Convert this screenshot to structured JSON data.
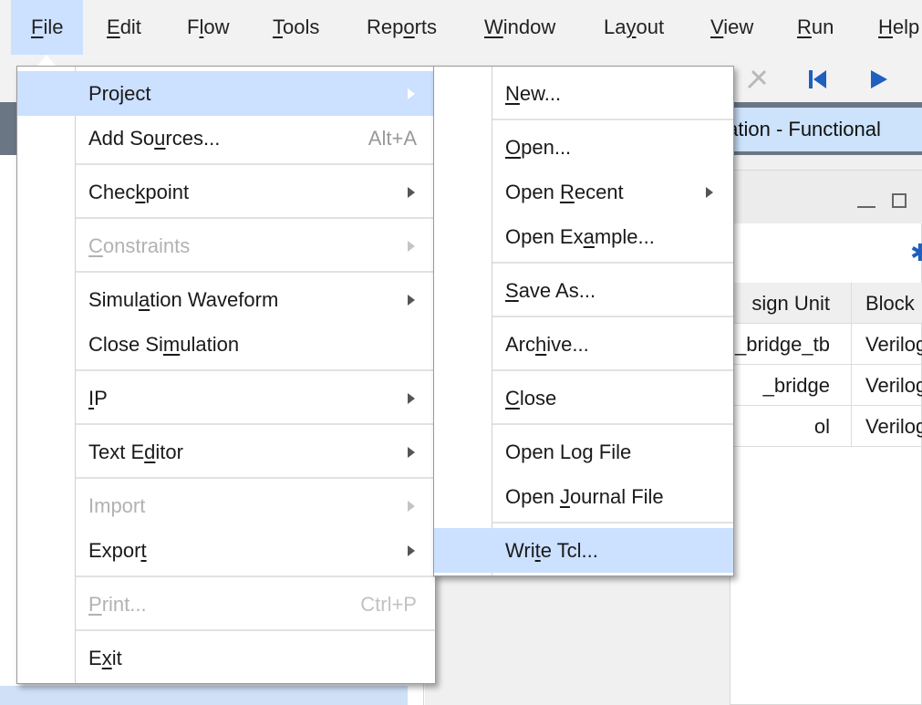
{
  "menubar": {
    "items": [
      {
        "pre": "",
        "u": "F",
        "post": "ile"
      },
      {
        "pre": "",
        "u": "E",
        "post": "dit"
      },
      {
        "pre": "F",
        "u": "l",
        "post": "ow"
      },
      {
        "pre": "",
        "u": "T",
        "post": "ools"
      },
      {
        "pre": "Rep",
        "u": "o",
        "post": "rts"
      },
      {
        "pre": "",
        "u": "W",
        "post": "indow"
      },
      {
        "pre": "La",
        "u": "y",
        "post": "out"
      },
      {
        "pre": "",
        "u": "V",
        "post": "iew"
      },
      {
        "pre": "",
        "u": "R",
        "post": "un"
      },
      {
        "pre": "",
        "u": "H",
        "post": "elp"
      }
    ]
  },
  "background": {
    "sim_banner": "ulation - Functional",
    "grid": {
      "col1_header": "sign Unit",
      "col2_header": "Block",
      "rows": [
        {
          "unit": "_bridge_tb",
          "block": "Verilog"
        },
        {
          "unit": "_bridge",
          "block": "Verilog"
        },
        {
          "unit": "ol",
          "block": "Verilog"
        }
      ]
    },
    "colors": {
      "selection": "#cce0ff",
      "header_dark": "#6b7685",
      "accent": "#1f5fbf"
    }
  },
  "file_menu": {
    "items": [
      {
        "pre": "Project",
        "u": "",
        "post": "",
        "shortcut": "",
        "submenu": true,
        "disabled": false,
        "selected": true
      },
      {
        "pre": "Add So",
        "u": "u",
        "post": "rces...",
        "shortcut": "Alt+A",
        "submenu": false,
        "disabled": false,
        "selected": false
      },
      {
        "pre": "Chec",
        "u": "k",
        "post": "point",
        "shortcut": "",
        "submenu": true,
        "disabled": false,
        "selected": false
      },
      {
        "pre": "",
        "u": "C",
        "post": "onstraints",
        "shortcut": "",
        "submenu": true,
        "disabled": true,
        "selected": false
      },
      {
        "pre": "Simul",
        "u": "a",
        "post": "tion Waveform",
        "shortcut": "",
        "submenu": true,
        "disabled": false,
        "selected": false
      },
      {
        "pre": "Close Si",
        "u": "m",
        "post": "ulation",
        "shortcut": "",
        "submenu": false,
        "disabled": false,
        "selected": false
      },
      {
        "pre": "",
        "u": "I",
        "post": "P",
        "shortcut": "",
        "submenu": true,
        "disabled": false,
        "selected": false
      },
      {
        "pre": "Text E",
        "u": "d",
        "post": "itor",
        "shortcut": "",
        "submenu": true,
        "disabled": false,
        "selected": false
      },
      {
        "pre": "",
        "u": "",
        "post": "Import",
        "shortcut": "",
        "submenu": true,
        "disabled": true,
        "selected": false
      },
      {
        "pre": "Expor",
        "u": "t",
        "post": "",
        "shortcut": "",
        "submenu": true,
        "disabled": false,
        "selected": false
      },
      {
        "pre": "",
        "u": "P",
        "post": "rint...",
        "shortcut": "Ctrl+P",
        "submenu": false,
        "disabled": true,
        "selected": false
      },
      {
        "pre": "E",
        "u": "x",
        "post": "it",
        "shortcut": "",
        "submenu": false,
        "disabled": false,
        "selected": false
      }
    ]
  },
  "project_menu": {
    "items": [
      {
        "pre": "",
        "u": "N",
        "post": "ew...",
        "submenu": false,
        "selected": false
      },
      {
        "pre": "",
        "u": "O",
        "post": "pen...",
        "submenu": false,
        "selected": false
      },
      {
        "pre": "Open ",
        "u": "R",
        "post": "ecent",
        "submenu": true,
        "selected": false
      },
      {
        "pre": "Open Ex",
        "u": "a",
        "post": "mple...",
        "submenu": false,
        "selected": false
      },
      {
        "pre": "",
        "u": "S",
        "post": "ave As...",
        "submenu": false,
        "selected": false
      },
      {
        "pre": "Arc",
        "u": "h",
        "post": "ive...",
        "submenu": false,
        "selected": false
      },
      {
        "pre": "",
        "u": "C",
        "post": "lose",
        "submenu": false,
        "selected": false
      },
      {
        "pre": "Open Lo",
        "u": "g",
        "post": " File",
        "submenu": false,
        "selected": false
      },
      {
        "pre": "Open ",
        "u": "J",
        "post": "ournal File",
        "submenu": false,
        "selected": false
      },
      {
        "pre": "Wri",
        "u": "t",
        "post": "e Tcl...",
        "submenu": false,
        "selected": true
      }
    ]
  }
}
